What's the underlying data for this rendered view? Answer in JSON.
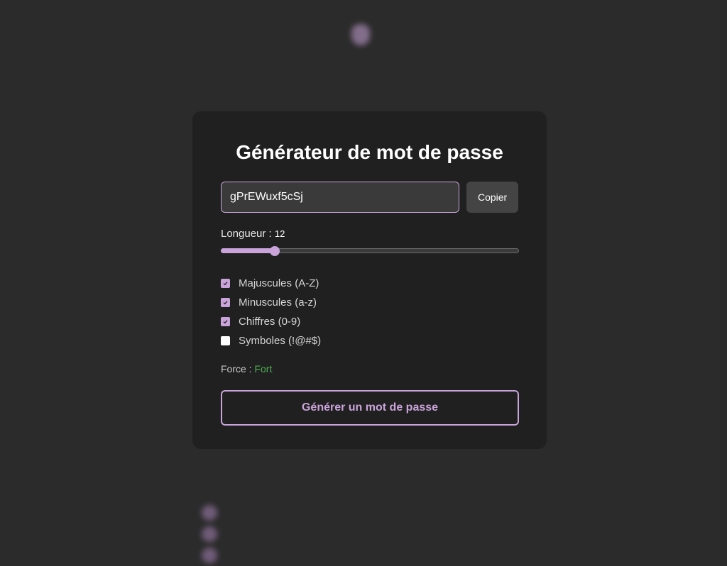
{
  "card": {
    "title": "Générateur de mot de passe",
    "password": "gPrEWuxf5cSj",
    "copy_label": "Copier",
    "length_label": "Longueur : ",
    "length_value": "12",
    "length_fraction": 0.18,
    "options": [
      {
        "label": "Majuscules (A-Z)",
        "checked": true
      },
      {
        "label": "Minuscules (a-z)",
        "checked": true
      },
      {
        "label": "Chiffres (0-9)",
        "checked": true
      },
      {
        "label": "Symboles (!@#$)",
        "checked": false
      }
    ],
    "strength_label": "Force : ",
    "strength_value": "Fort",
    "generate_label": "Générer un mot de passe"
  },
  "colors": {
    "accent": "#c9a3d9",
    "strength_strong": "#4caf50",
    "background": "#2b2b2b",
    "card": "#202020"
  },
  "icons": {
    "checkbox_check": "checkmark-icon"
  }
}
